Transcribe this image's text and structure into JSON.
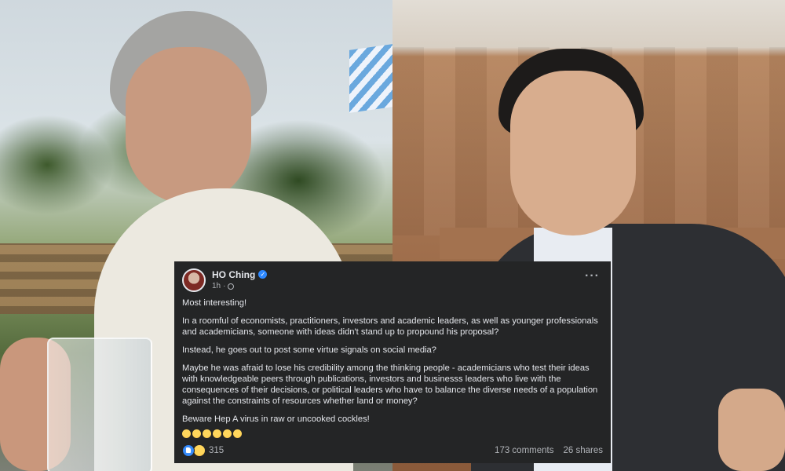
{
  "post": {
    "author": "HO Ching",
    "time": "1h",
    "paragraphs": [
      "Most interesting!",
      "In a roomful of economists, practitioners, investors and academic leaders, as well as younger professionals and academicians, someone with ideas didn't stand up to propound his proposal?",
      "Instead, he goes out to post some virtue signals on social media?",
      "Maybe he was afraid to lose his credibility among the thinking people - academicians who test their ideas with knowledgeable peers through publications, investors and businesss leaders who live with the consequences of their decisions, or political leaders who have to balance the diverse needs of a population against the constraints of resources whether land or money?",
      "Beware Hep A virus in raw or uncooked cockles!"
    ],
    "emojis": [
      "grinning-squinting",
      "grinning-squinting",
      "rolling-laughing",
      "rolling-laughing",
      "grinning-sweat",
      "smirk"
    ],
    "reactions_count": "315",
    "comments": "173 comments",
    "shares": "26 shares",
    "reaction_icons": [
      "like-icon",
      "haha-icon"
    ],
    "colors": {
      "card_bg": "#242526",
      "text": "#e4e6eb",
      "secondary_text": "#b0b3b8",
      "verified_blue": "#2d88ff",
      "like_blue": "#1877f2"
    }
  },
  "photos": {
    "left": "woman-with-beer-mug-photo",
    "right": "man-speaking-in-parliament-photo"
  }
}
